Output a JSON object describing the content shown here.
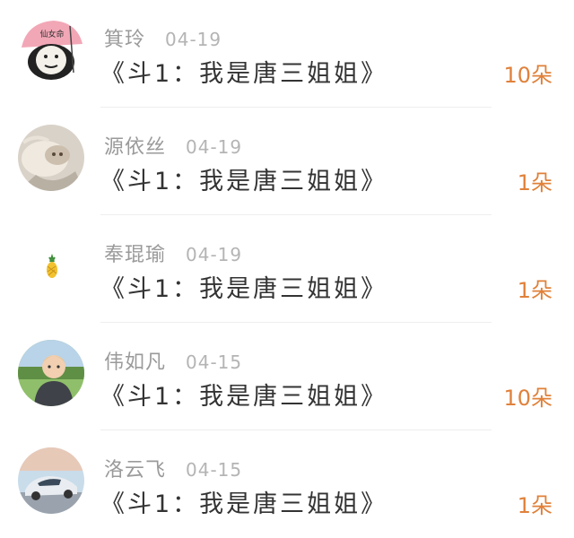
{
  "gifts": [
    {
      "name": "箕玲",
      "date": "04-19",
      "title": "《斗1：我是唐三姐姐》",
      "count": "10朵",
      "avatar": "panda-meme-avatar",
      "avatar_text": "仙女命"
    },
    {
      "name": "源依丝",
      "date": "04-19",
      "title": "《斗1：我是唐三姐姐》",
      "count": "1朵",
      "avatar": "cat-photo-avatar"
    },
    {
      "name": "奉琨瑜",
      "date": "04-19",
      "title": "《斗1：我是唐三姐姐》",
      "count": "1朵",
      "avatar": "pineapple-avatar"
    },
    {
      "name": "伟如凡",
      "date": "04-15",
      "title": "《斗1：我是唐三姐姐》",
      "count": "10朵",
      "avatar": "boy-photo-avatar"
    },
    {
      "name": "洛云飞",
      "date": "04-15",
      "title": "《斗1：我是唐三姐姐》",
      "count": "1朵",
      "avatar": "car-photo-avatar"
    }
  ]
}
